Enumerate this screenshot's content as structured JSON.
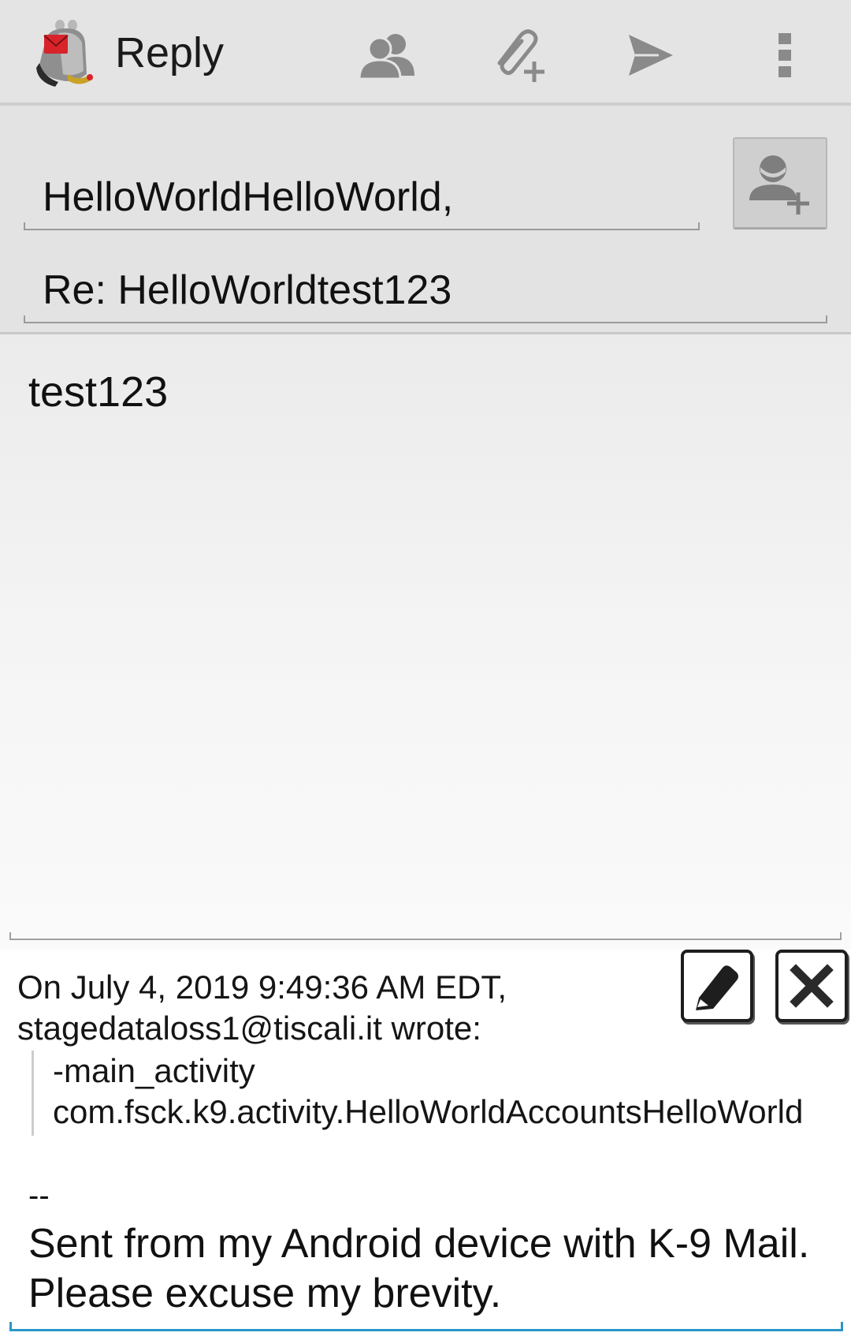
{
  "action_bar": {
    "app_icon": "k9-mail-dog-icon",
    "title": "Reply",
    "actions": [
      {
        "name": "contacts-icon",
        "label": "Add from contacts"
      },
      {
        "name": "attachment-add-icon",
        "label": "Add attachment"
      },
      {
        "name": "send-icon",
        "label": "Send"
      },
      {
        "name": "overflow-menu-icon",
        "label": "More options"
      }
    ]
  },
  "compose": {
    "to_value": "HelloWorldHelloWorld,",
    "add_contact_icon": "add-contact-icon",
    "subject_value": "Re: HelloWorldtest123",
    "body_value": "test123"
  },
  "quote": {
    "header_line1": "On July 4, 2019 9:49:36 AM EDT,",
    "header_line2": "stagedataloss1@tiscali.it wrote:",
    "quoted_line1": "-main_activity",
    "quoted_line2": "com.fsck.k9.activity.HelloWorldAccountsHelloWorld",
    "edit_icon": "pencil-icon",
    "remove_icon": "close-icon"
  },
  "signature": {
    "separator": "--",
    "text": "Sent from my Android device with K-9 Mail. Please excuse my brevity."
  },
  "colors": {
    "action_bar_bg": "#e4e4e4",
    "header_bg": "#e3e3e3",
    "focus_accent": "#2a97c7",
    "icon_gray": "#8a8a8a",
    "k9_red": "#d8232a"
  }
}
